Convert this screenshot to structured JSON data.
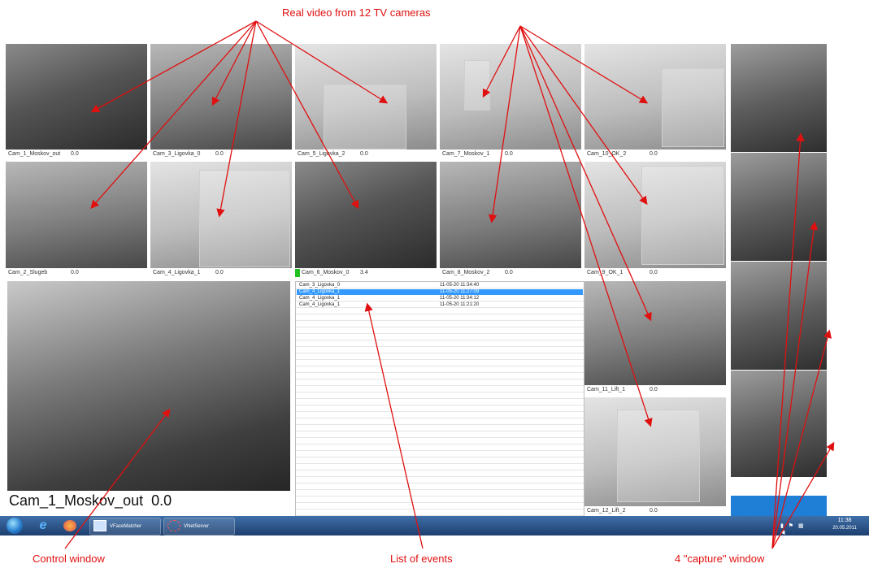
{
  "annotations": {
    "top": "Real video from 12 TV cameras",
    "control": "Control window",
    "events": "List of events",
    "capture": "4 \"capture\" window"
  },
  "cameras": [
    {
      "name": "Cam_1_Moskov_out",
      "value": "0.0"
    },
    {
      "name": "Cam_3_Ligovka_0",
      "value": "0.0"
    },
    {
      "name": "Cam_5_Ligovka_2",
      "value": "0.0"
    },
    {
      "name": "Cam_7_Moskov_1",
      "value": "0.0"
    },
    {
      "name": "Cam_10_OK_2",
      "value": "0.0"
    },
    {
      "name": "Cam_2_Slugeb",
      "value": "0.0"
    },
    {
      "name": "Cam_4_Ligovka_1",
      "value": "0.0"
    },
    {
      "name": "Cam_6_Moskov_0",
      "value": "3.4"
    },
    {
      "name": "Cam_8_Moskov_2",
      "value": "0.0"
    },
    {
      "name": "Cam_9_OK_1",
      "value": "0.0"
    },
    {
      "name": "Cam_11_Lift_1",
      "value": "0.0"
    },
    {
      "name": "Cam_12_Lift_2",
      "value": "0.0"
    }
  ],
  "control_window": {
    "label": "Cam_1_Moskov_out  0.0"
  },
  "events": [
    {
      "camera": "Cam_3_Ligovka_0",
      "time": "11-05-20 11:34:40",
      "selected": false
    },
    {
      "camera": "Cam_4_Ligovka_1",
      "time": "11-05-20 11:27:09",
      "selected": true
    },
    {
      "camera": "Cam_4_Ligovka_1",
      "time": "11-05-20 11:34:12",
      "selected": false
    },
    {
      "camera": "Cam_4_Ligovka_1",
      "time": "11-05-20 11:21:20",
      "selected": false
    }
  ],
  "taskbar": {
    "apps": [
      "VFaceMatcher",
      "VNetServer"
    ],
    "time": "11:38",
    "date": "20.05.2011"
  },
  "colors": {
    "annotation": "#e01010",
    "selection": "#3399ff",
    "taskbar": "#1d3f6e"
  }
}
